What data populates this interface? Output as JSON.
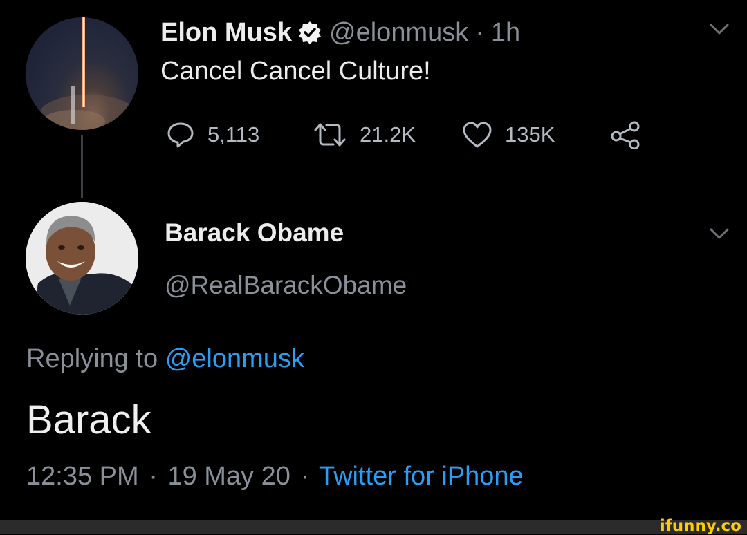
{
  "tweet": {
    "author_name": "Elon Musk",
    "author_handle": "@elonmusk",
    "separator": "·",
    "time_ago": "1h",
    "text": "Cancel Cancel Culture!",
    "replies": "5,113",
    "retweets": "21.2K",
    "likes": "135K"
  },
  "reply": {
    "author_name": "Barack Obame",
    "author_handle": "@RealBarackObame",
    "replying_prefix": "Replying to",
    "replying_handle": "@elonmusk",
    "text": "Barack",
    "time": "12:35 PM",
    "separator1": "·",
    "date": "19 May 20",
    "separator2": "·",
    "source": "Twitter for iPhone"
  },
  "watermark": "ifunny.co",
  "colors": {
    "background": "#000000",
    "link": "#2a9df4",
    "muted": "#8a9099",
    "verified": "#f2f2f2"
  },
  "icons": [
    "verified-badge-icon",
    "chevron-down-icon",
    "reply-icon",
    "retweet-icon",
    "like-icon",
    "share-icon"
  ]
}
